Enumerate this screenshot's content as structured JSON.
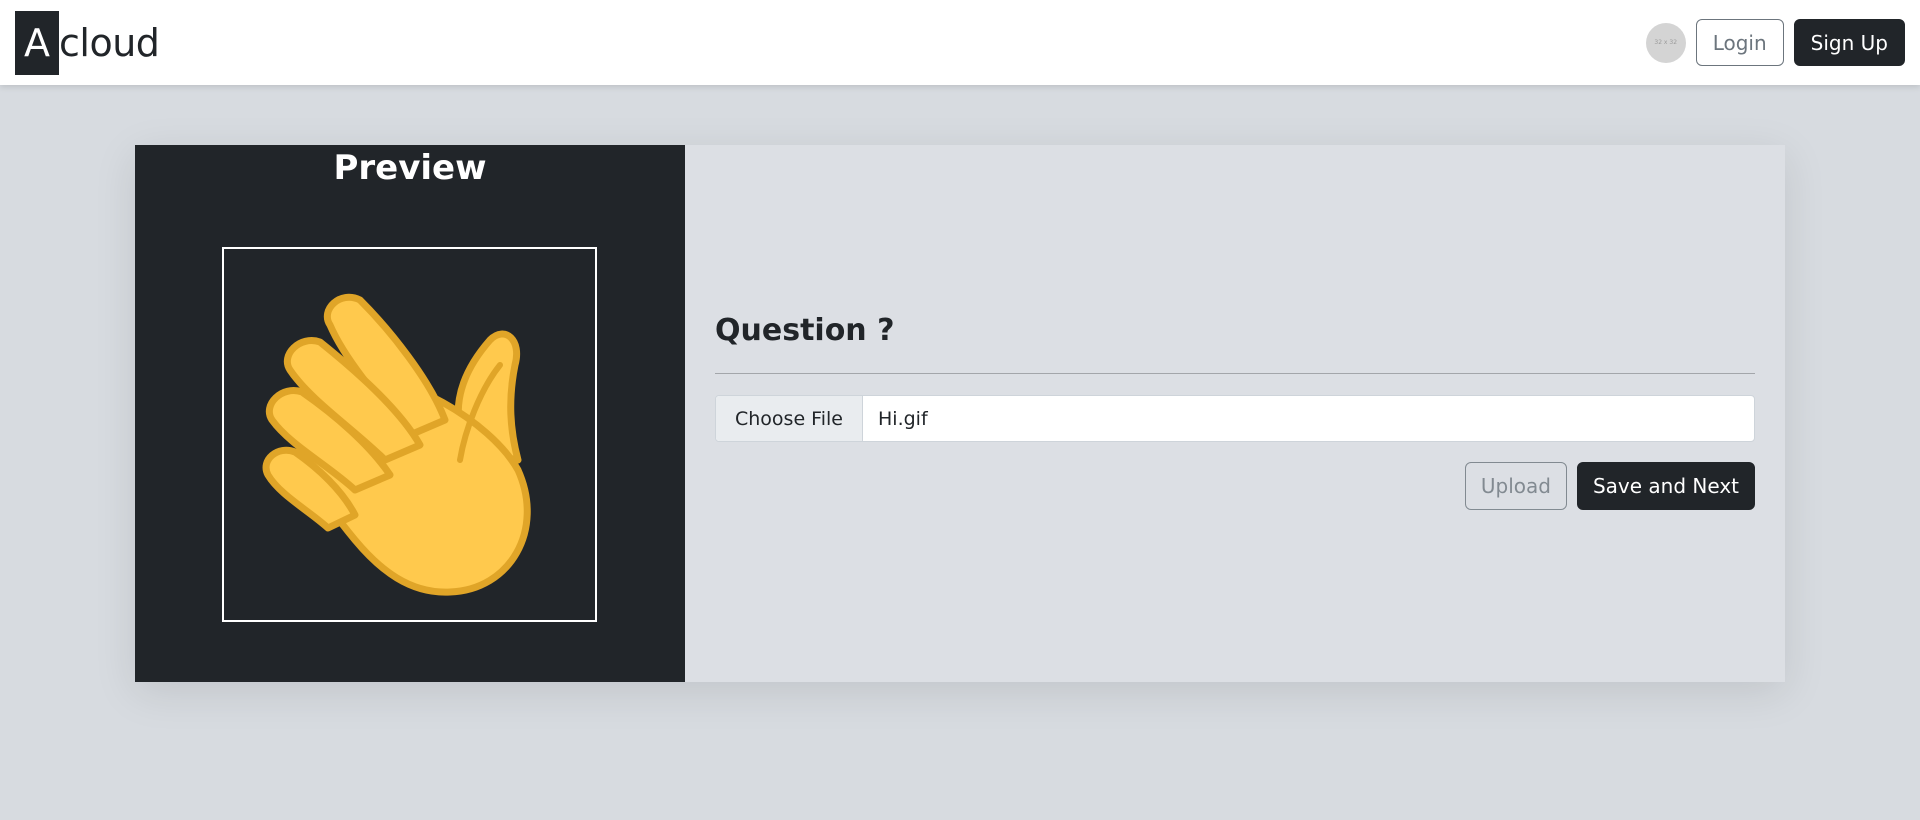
{
  "navbar": {
    "brand_initial": "A",
    "brand_rest": "cloud",
    "avatar_text": "32 x 32",
    "login_label": "Login",
    "signup_label": "Sign Up"
  },
  "preview": {
    "title": "Preview",
    "image_icon": "waving-hand-icon"
  },
  "form": {
    "question": "Question ?",
    "choose_file_label": "Choose File",
    "file_name": "Hi.gif",
    "upload_label": "Upload",
    "save_next_label": "Save and Next"
  },
  "colors": {
    "dark": "#212529",
    "page_bg": "#d7dbe0",
    "form_bg": "#dcdfe4",
    "hand_fill": "#ffc94d",
    "hand_stroke": "#e0a528"
  }
}
